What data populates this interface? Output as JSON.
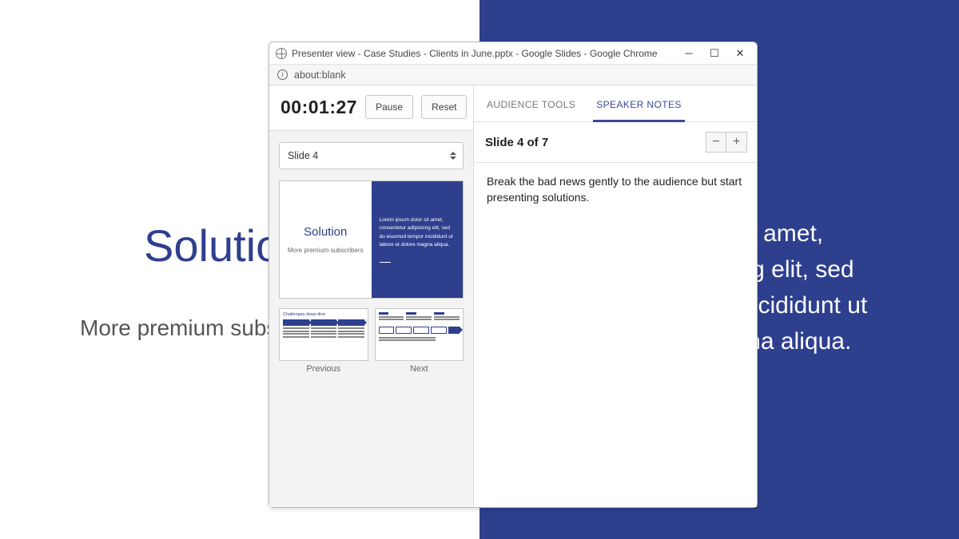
{
  "background": {
    "title": "Solution",
    "subtitle": "More premium subscribers",
    "right_text": "Lorem ipsum dolor sit amet, consectetur adipiscing elit, sed do eiusmod tempor incididunt ut labore et dolore magna aliqua."
  },
  "window": {
    "title": "Presenter view - Case Studies - Clients in June.pptx - Google Slides - Google Chrome",
    "address_info_char": "i",
    "address": "about:blank",
    "minimize": "─",
    "maximize": "☐",
    "close": "✕"
  },
  "presenter": {
    "timer": "00:01:27",
    "pause_label": "Pause",
    "reset_label": "Reset",
    "slide_selector": "Slide 4",
    "current_thumb": {
      "title": "Solution",
      "subtitle": "More premium subscribers",
      "body": "Lorem ipsum dolor sit amet, consectetur adipiscing elit, sed do eiusmod tempor incididunt ut labore et dolore magna aliqua."
    },
    "previous_label": "Previous",
    "next_label": "Next",
    "prev_thumb_title": "Challenges deep-dive"
  },
  "tabs": {
    "audience_tools": "AUDIENCE TOOLS",
    "speaker_notes": "SPEAKER NOTES"
  },
  "notes": {
    "header": "Slide 4 of 7",
    "minus": "−",
    "plus": "+",
    "body": "Break the bad news gently to the audience but start presenting solutions."
  }
}
